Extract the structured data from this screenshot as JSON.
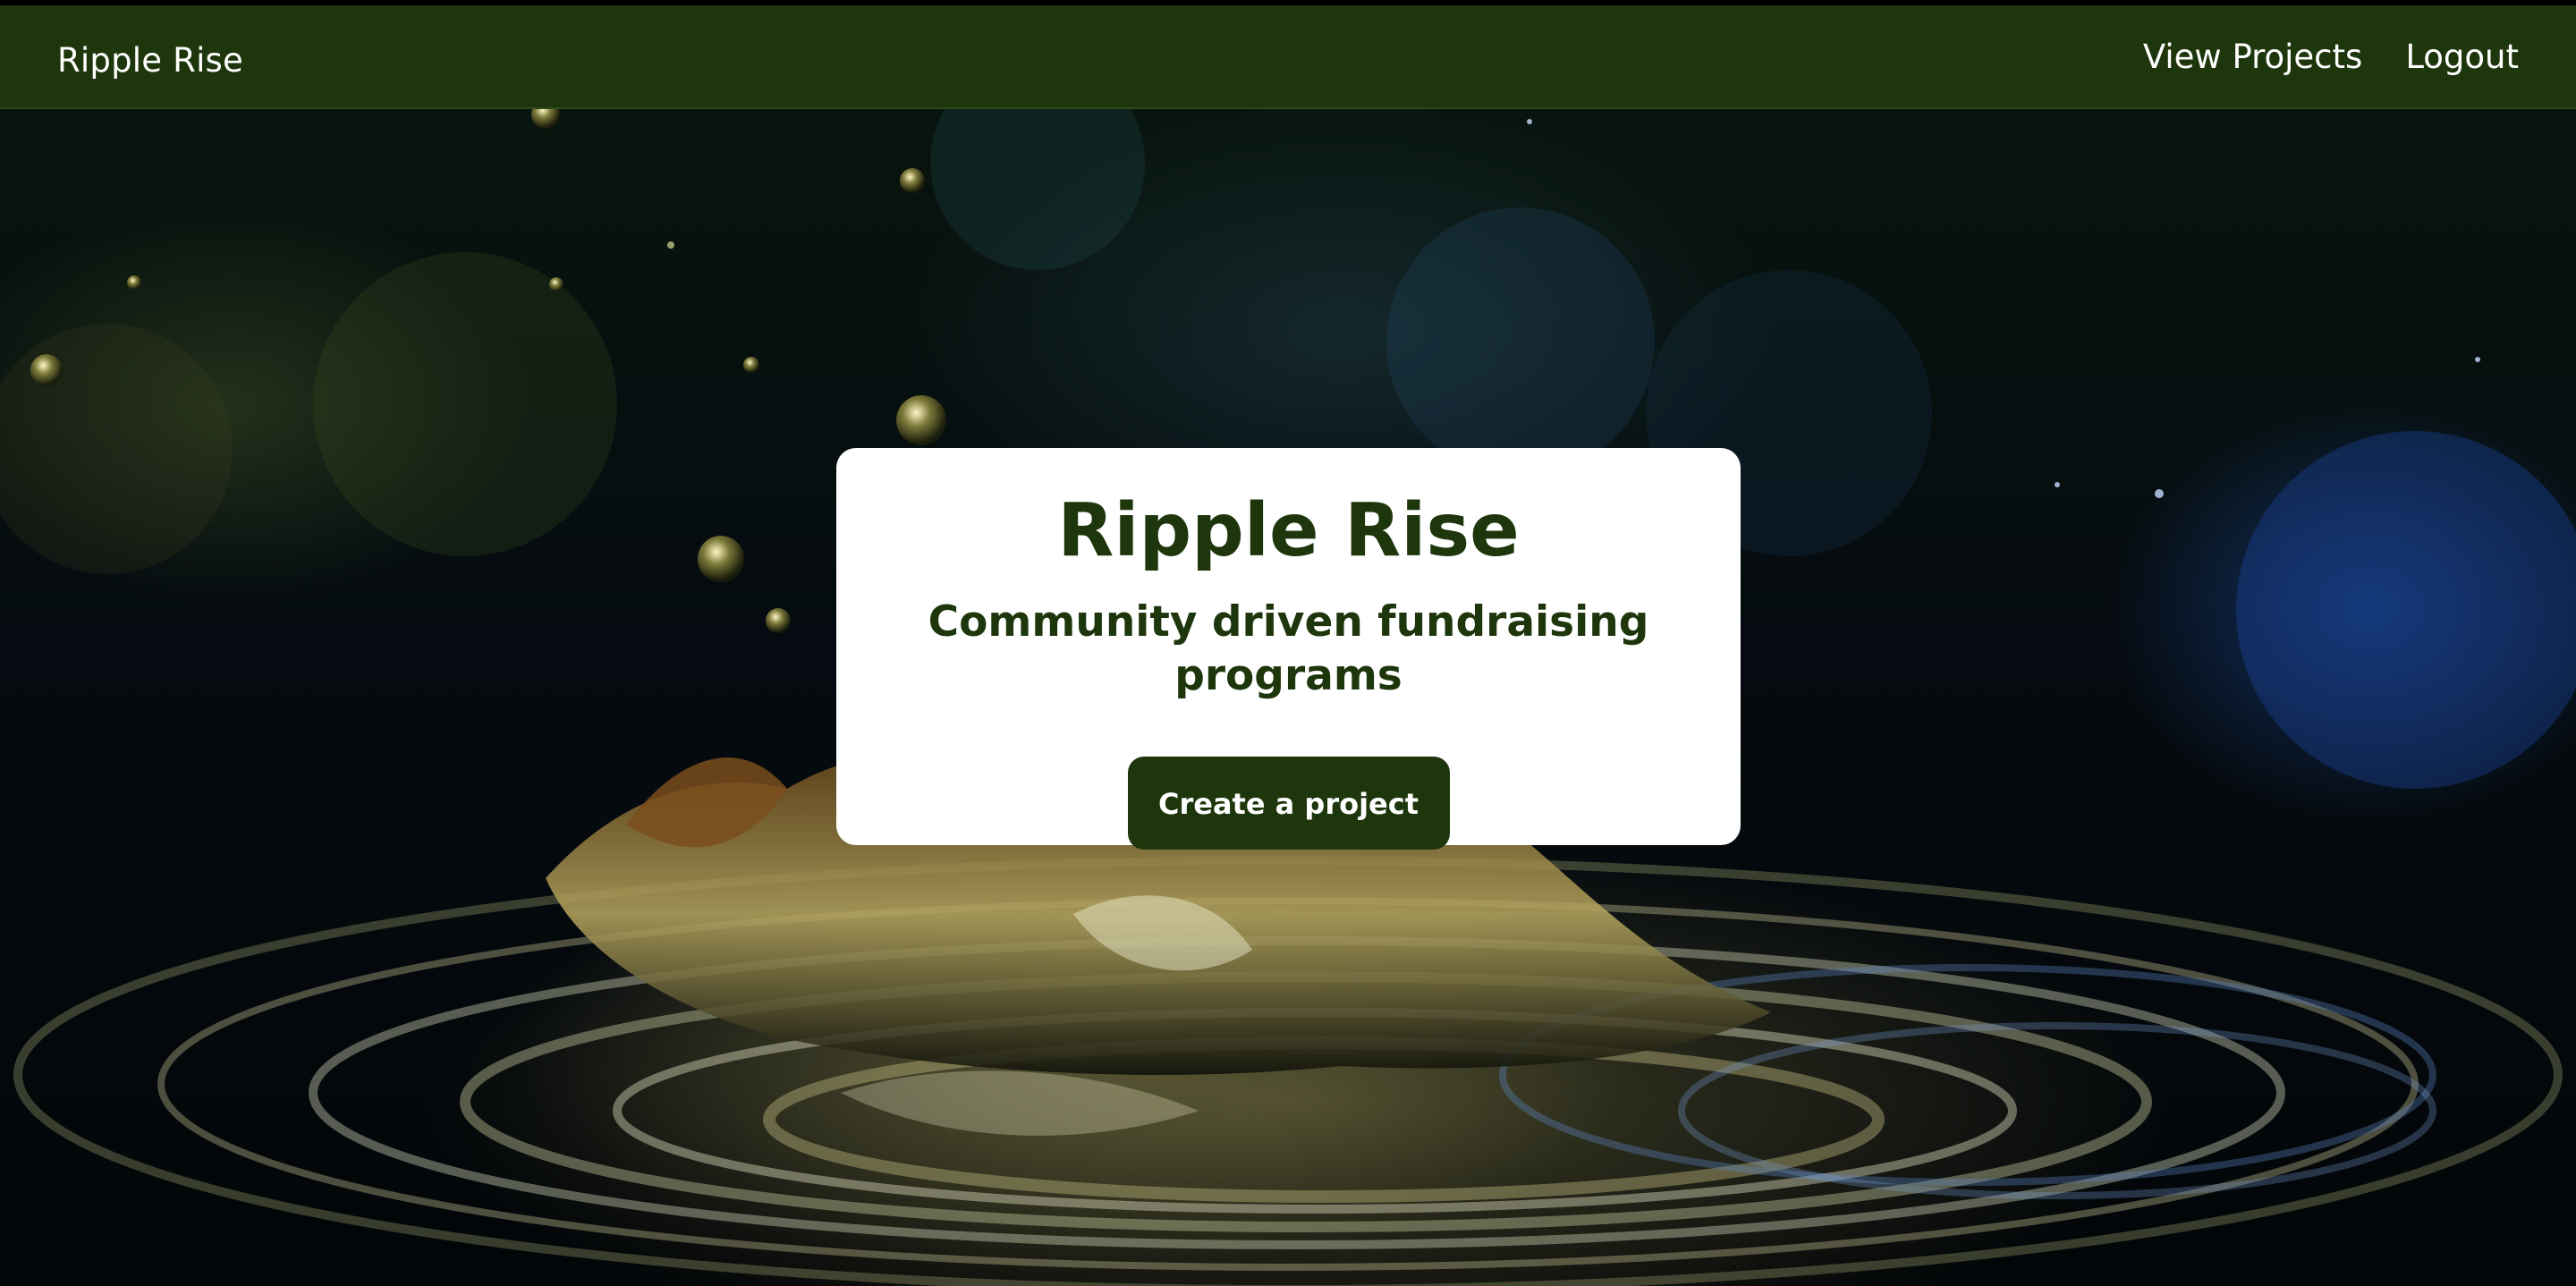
{
  "header": {
    "brand": "Ripple Rise",
    "nav": {
      "view_projects": "View Projects",
      "logout": "Logout"
    }
  },
  "hero": {
    "title": "Ripple Rise",
    "subtitle": "Community driven fundraising programs",
    "cta_label": "Create a project",
    "background_image": "water-splash-photo"
  },
  "colors": {
    "brand_green": "#1e360c",
    "card_background": "#ffffff",
    "text_on_dark": "#ffffff"
  }
}
